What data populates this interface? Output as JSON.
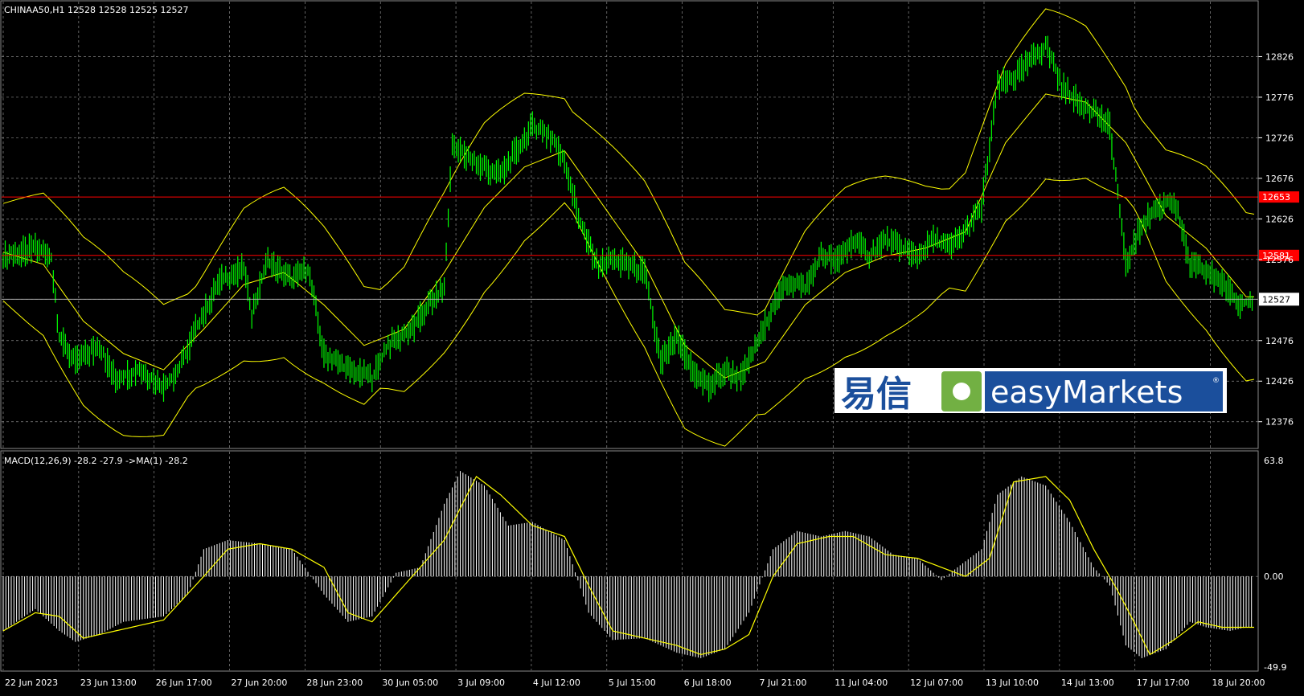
{
  "colors": {
    "background": "#000000",
    "grid": "#8a8a8a",
    "candles": "#00ff00",
    "bands": "#ffff00",
    "levels": "#ff0000",
    "price_tag_bg": "#ffffff",
    "histogram": "#ffffff",
    "signal": "#ffff00",
    "axis_text": "#ffffff",
    "logo_blue": "#1b4f9c",
    "logo_green": "#72b043"
  },
  "header": {
    "symbol_info": "CHINAA50,H1  12528 12528 12525 12527"
  },
  "macd_header": "MACD(12,26,9) -28.2 -27.9  ->MA(1) -28.2",
  "logo": {
    "chinese": "易信",
    "wordmark": "easyMarkets",
    "icon": "easymarkets-leaf-icon"
  },
  "chart_data": [
    {
      "type": "candlestick",
      "title": "CHINAA50,H1",
      "ohlc_last": {
        "open": 12528,
        "high": 12528,
        "low": 12525,
        "close": 12527
      },
      "ylim": [
        12346,
        12876
      ],
      "y_ticks": [
        12376,
        12426,
        12476,
        12527,
        12576,
        12626,
        12676,
        12726,
        12776,
        12826
      ],
      "x_ticks": [
        "22 Jun 2023",
        "23 Jun 13:00",
        "26 Jun 17:00",
        "27 Jun 20:00",
        "28 Jun 23:00",
        "30 Jun 05:00",
        "3 Jul 09:00",
        "4 Jul 12:00",
        "5 Jul 15:00",
        "6 Jul 18:00",
        "7 Jul 21:00",
        "11 Jul 04:00",
        "12 Jul 07:00",
        "13 Jul 10:00",
        "14 Jul 13:00",
        "17 Jul 17:00",
        "18 Jul 20:00"
      ],
      "price_path": [
        [
          0,
          12580
        ],
        [
          2,
          12585
        ],
        [
          4,
          12590
        ],
        [
          6,
          12578
        ],
        [
          7,
          12480
        ],
        [
          9,
          12450
        ],
        [
          12,
          12470
        ],
        [
          14,
          12430
        ],
        [
          17,
          12440
        ],
        [
          20,
          12420
        ],
        [
          22,
          12440
        ],
        [
          24,
          12490
        ],
        [
          27,
          12550
        ],
        [
          30,
          12565
        ],
        [
          31,
          12510
        ],
        [
          33,
          12575
        ],
        [
          36,
          12550
        ],
        [
          38,
          12565
        ],
        [
          40,
          12460
        ],
        [
          43,
          12440
        ],
        [
          46,
          12430
        ],
        [
          48,
          12470
        ],
        [
          51,
          12490
        ],
        [
          53,
          12520
        ],
        [
          55,
          12540
        ],
        [
          56,
          12720
        ],
        [
          58,
          12700
        ],
        [
          60,
          12690
        ],
        [
          62,
          12680
        ],
        [
          64,
          12710
        ],
        [
          66,
          12740
        ],
        [
          68,
          12730
        ],
        [
          70,
          12700
        ],
        [
          72,
          12620
        ],
        [
          74,
          12570
        ],
        [
          76,
          12575
        ],
        [
          78,
          12570
        ],
        [
          80,
          12560
        ],
        [
          82,
          12450
        ],
        [
          84,
          12480
        ],
        [
          86,
          12440
        ],
        [
          88,
          12420
        ],
        [
          90,
          12440
        ],
        [
          92,
          12430
        ],
        [
          94,
          12470
        ],
        [
          96,
          12520
        ],
        [
          98,
          12550
        ],
        [
          100,
          12540
        ],
        [
          102,
          12580
        ],
        [
          104,
          12575
        ],
        [
          106,
          12600
        ],
        [
          108,
          12580
        ],
        [
          110,
          12600
        ],
        [
          112,
          12590
        ],
        [
          114,
          12580
        ],
        [
          116,
          12600
        ],
        [
          118,
          12590
        ],
        [
          120,
          12610
        ],
        [
          122,
          12640
        ],
        [
          124,
          12790
        ],
        [
          126,
          12800
        ],
        [
          128,
          12820
        ],
        [
          130,
          12840
        ],
        [
          132,
          12790
        ],
        [
          134,
          12770
        ],
        [
          136,
          12760
        ],
        [
          138,
          12740
        ],
        [
          140,
          12570
        ],
        [
          142,
          12620
        ],
        [
          144,
          12640
        ],
        [
          146,
          12650
        ],
        [
          148,
          12570
        ],
        [
          150,
          12560
        ],
        [
          152,
          12550
        ],
        [
          154,
          12520
        ],
        [
          156,
          12527
        ]
      ],
      "band_mid_path": [
        [
          0,
          12585
        ],
        [
          5,
          12570
        ],
        [
          10,
          12500
        ],
        [
          15,
          12460
        ],
        [
          20,
          12440
        ],
        [
          25,
          12490
        ],
        [
          30,
          12545
        ],
        [
          35,
          12560
        ],
        [
          40,
          12520
        ],
        [
          45,
          12470
        ],
        [
          50,
          12490
        ],
        [
          55,
          12560
        ],
        [
          60,
          12640
        ],
        [
          65,
          12690
        ],
        [
          70,
          12710
        ],
        [
          75,
          12640
        ],
        [
          80,
          12570
        ],
        [
          85,
          12470
        ],
        [
          90,
          12430
        ],
        [
          95,
          12450
        ],
        [
          100,
          12520
        ],
        [
          105,
          12560
        ],
        [
          110,
          12580
        ],
        [
          115,
          12590
        ],
        [
          120,
          12610
        ],
        [
          125,
          12720
        ],
        [
          130,
          12780
        ],
        [
          135,
          12770
        ],
        [
          140,
          12720
        ],
        [
          145,
          12630
        ],
        [
          150,
          12590
        ],
        [
          155,
          12530
        ]
      ],
      "bands_note": "Bollinger bands (yellow) around price",
      "horizontal_levels": [
        12653,
        12581
      ],
      "current_price_tag": 12527,
      "current_price_tag_label": "12527",
      "level_tag_labels": [
        "12653",
        "12581"
      ]
    },
    {
      "type": "bar",
      "title": "MACD(12,26,9)",
      "values_header": {
        "macd": -28.2,
        "signal": -27.9,
        "ma": -28.2
      },
      "ylim": [
        -49.9,
        63.8
      ],
      "y_ticks": [
        "63.8",
        "0.00",
        "-49.9"
      ],
      "macd_path": [
        [
          0,
          -30
        ],
        [
          4,
          -18
        ],
        [
          7,
          -30
        ],
        [
          9,
          -36
        ],
        [
          12,
          -32
        ],
        [
          15,
          -25
        ],
        [
          20,
          -22
        ],
        [
          23,
          -10
        ],
        [
          25,
          15
        ],
        [
          28,
          20
        ],
        [
          32,
          18
        ],
        [
          36,
          15
        ],
        [
          40,
          -10
        ],
        [
          43,
          -25
        ],
        [
          46,
          -22
        ],
        [
          49,
          2
        ],
        [
          52,
          5
        ],
        [
          55,
          40
        ],
        [
          57,
          58
        ],
        [
          60,
          50
        ],
        [
          63,
          28
        ],
        [
          66,
          30
        ],
        [
          70,
          20
        ],
        [
          73,
          -20
        ],
        [
          76,
          -35
        ],
        [
          80,
          -34
        ],
        [
          84,
          -42
        ],
        [
          87,
          -45
        ],
        [
          90,
          -40
        ],
        [
          93,
          -20
        ],
        [
          96,
          15
        ],
        [
          99,
          25
        ],
        [
          102,
          22
        ],
        [
          105,
          25
        ],
        [
          108,
          22
        ],
        [
          111,
          12
        ],
        [
          114,
          10
        ],
        [
          117,
          -2
        ],
        [
          119,
          5
        ],
        [
          122,
          15
        ],
        [
          124,
          45
        ],
        [
          127,
          55
        ],
        [
          130,
          50
        ],
        [
          133,
          30
        ],
        [
          136,
          5
        ],
        [
          138,
          -5
        ],
        [
          140,
          -38
        ],
        [
          142,
          -45
        ],
        [
          145,
          -40
        ],
        [
          148,
          -25
        ],
        [
          150,
          -28
        ],
        [
          153,
          -30
        ],
        [
          155,
          -28
        ]
      ],
      "signal_path": [
        [
          0,
          -30
        ],
        [
          4,
          -20
        ],
        [
          7,
          -22
        ],
        [
          10,
          -34
        ],
        [
          14,
          -30
        ],
        [
          20,
          -24
        ],
        [
          25,
          0
        ],
        [
          28,
          15
        ],
        [
          32,
          18
        ],
        [
          36,
          15
        ],
        [
          40,
          5
        ],
        [
          43,
          -20
        ],
        [
          46,
          -25
        ],
        [
          50,
          -5
        ],
        [
          55,
          20
        ],
        [
          59,
          55
        ],
        [
          62,
          45
        ],
        [
          66,
          28
        ],
        [
          70,
          22
        ],
        [
          73,
          -5
        ],
        [
          76,
          -30
        ],
        [
          80,
          -34
        ],
        [
          84,
          -38
        ],
        [
          87,
          -43
        ],
        [
          90,
          -40
        ],
        [
          93,
          -32
        ],
        [
          96,
          0
        ],
        [
          99,
          18
        ],
        [
          103,
          22
        ],
        [
          106,
          22
        ],
        [
          110,
          12
        ],
        [
          114,
          10
        ],
        [
          117,
          5
        ],
        [
          120,
          0
        ],
        [
          123,
          10
        ],
        [
          126,
          52
        ],
        [
          130,
          55
        ],
        [
          133,
          42
        ],
        [
          136,
          15
        ],
        [
          139,
          -8
        ],
        [
          141,
          -25
        ],
        [
          143,
          -43
        ],
        [
          146,
          -35
        ],
        [
          149,
          -25
        ],
        [
          152,
          -28
        ],
        [
          155,
          -28
        ]
      ]
    }
  ]
}
